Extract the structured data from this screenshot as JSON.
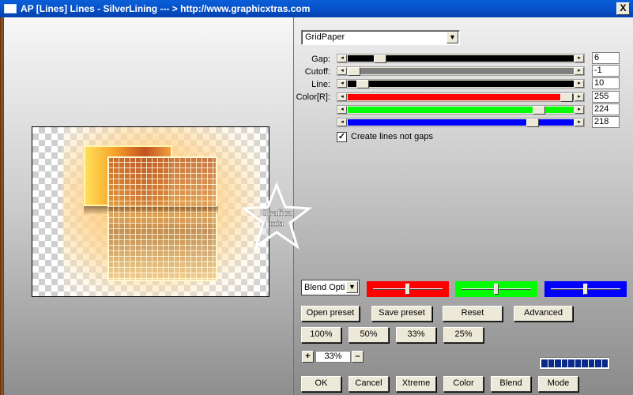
{
  "window": {
    "title": "AP [Lines]  Lines - SilverLining    --- > http://www.graphicxtras.com",
    "close_label": "X"
  },
  "preview": {
    "watermark_text_line1": "Grafica",
    "watermark_text_line2": "mia"
  },
  "preset_dropdown": {
    "value": "GridPaper",
    "arrow": "▼"
  },
  "sliders": [
    {
      "label": "Gap:",
      "value": "6",
      "track_color": "#000000",
      "position": 0.12
    },
    {
      "label": "Cutoff:",
      "value": "-1",
      "track_color": "#808080",
      "position": 0.0
    },
    {
      "label": "Line:",
      "value": "10",
      "track_color": "#000000",
      "position": 0.04
    },
    {
      "label": "Color[R]:",
      "value": "255",
      "track_color": "#ff0000",
      "position": 0.99
    },
    {
      "label": "",
      "value": "224",
      "track_color": "#00ff00",
      "position": 0.86
    },
    {
      "label": "",
      "value": "218",
      "track_color": "#0000ff",
      "position": 0.83
    }
  ],
  "arrows": {
    "left": "◂",
    "right": "▸"
  },
  "create_lines": {
    "checked_mark": "✓",
    "label": "Create lines not gaps"
  },
  "blend": {
    "select_value": "Blend Optio",
    "color_sliders": [
      {
        "color": "#ff0000",
        "position": 0.5
      },
      {
        "color": "#00ff00",
        "position": 0.5
      },
      {
        "color": "#0000ff",
        "position": 0.5
      }
    ]
  },
  "buttons": {
    "open_preset": "Open preset",
    "save_preset": "Save preset",
    "reset": "Reset",
    "advanced": "Advanced",
    "zoom_100": "100%",
    "zoom_50": "50%",
    "zoom_33": "33%",
    "zoom_25": "25%",
    "ok": "OK",
    "cancel": "Cancel",
    "xtreme": "Xtreme",
    "color": "Color",
    "blend": "Blend",
    "mode": "Mode"
  },
  "zoom": {
    "plus": "+",
    "minus": "–",
    "value": "33%"
  },
  "progress": {
    "segments": 10
  }
}
